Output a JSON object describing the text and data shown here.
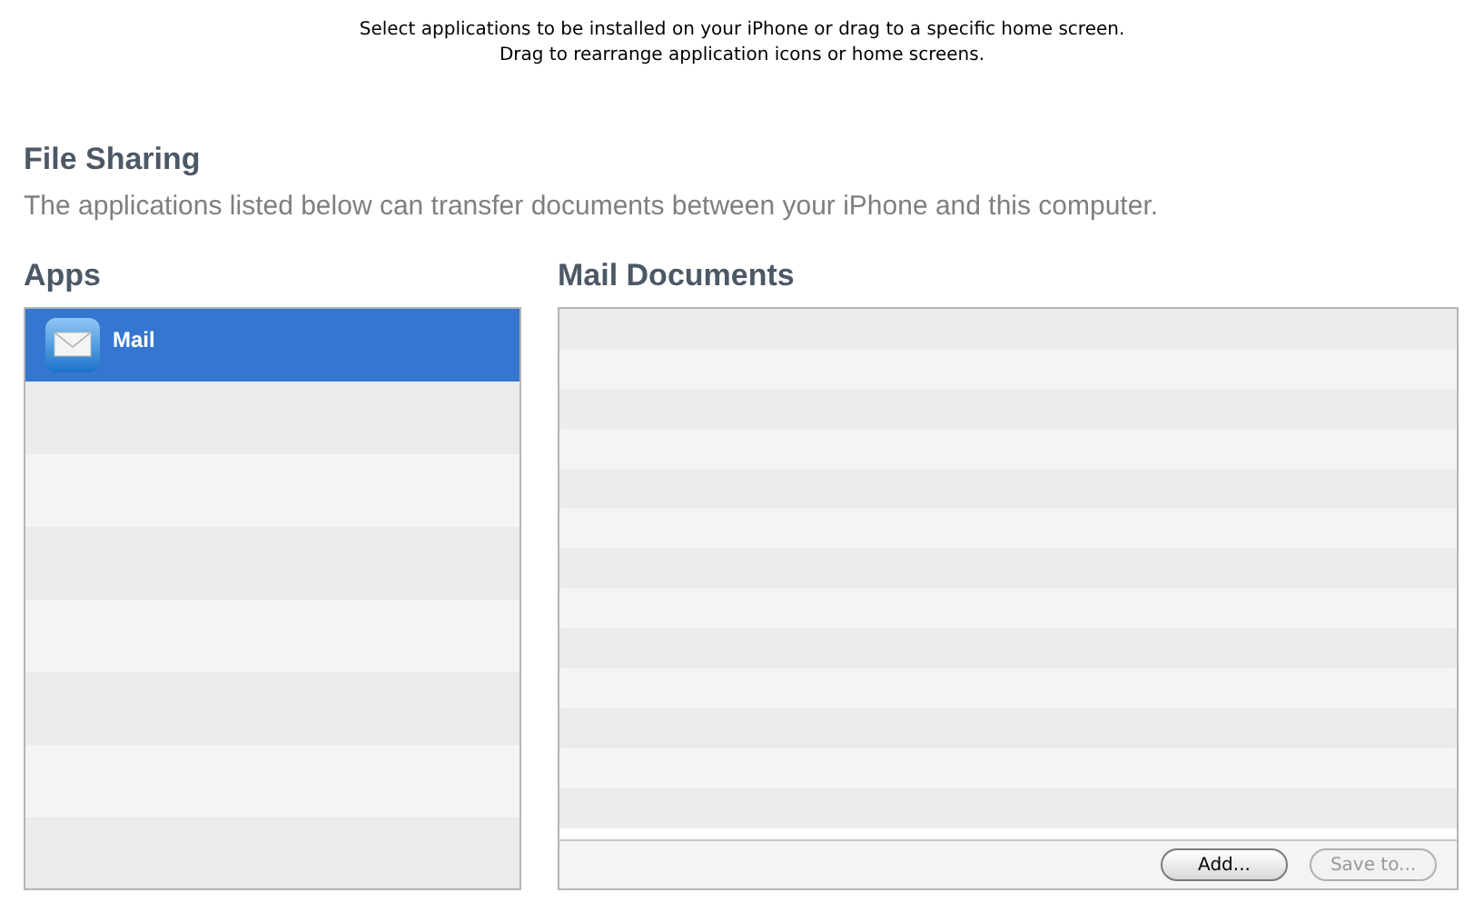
{
  "instructions": [
    "Select applications to be installed on your iPhone or drag to a specific home screen.",
    "Drag to rearrange application icons or home screens."
  ],
  "file_sharing": {
    "title": "File Sharing",
    "description": "The applications listed below can transfer documents between your iPhone and this computer."
  },
  "apps": {
    "heading": "Apps",
    "items": [
      {
        "name": "Mail",
        "selected": true
      }
    ]
  },
  "documents": {
    "heading": "Mail Documents",
    "buttons": [
      {
        "label": "Add...",
        "disabled": false
      },
      {
        "label": "Save to...",
        "disabled": true
      }
    ]
  }
}
